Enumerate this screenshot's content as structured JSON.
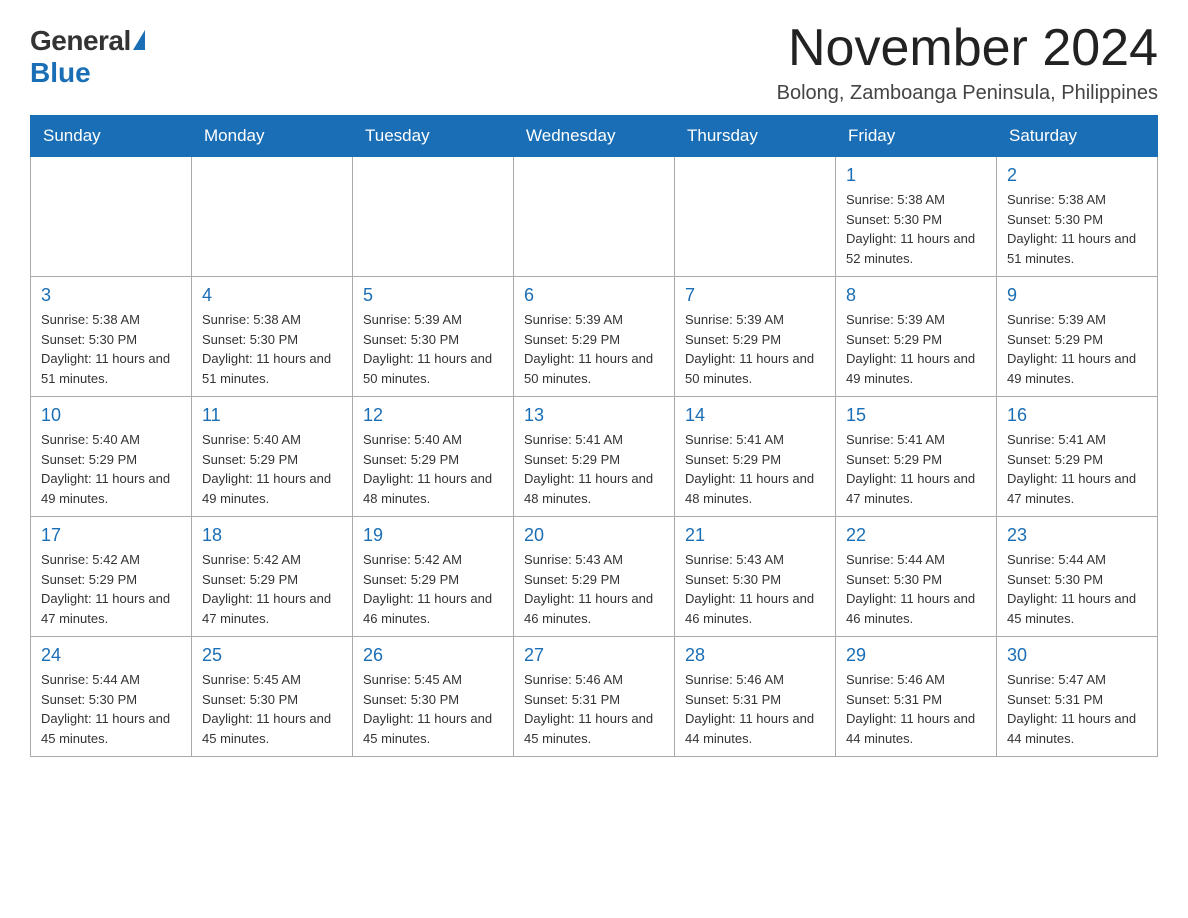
{
  "logo": {
    "general": "General",
    "blue": "Blue"
  },
  "header": {
    "month_title": "November 2024",
    "location": "Bolong, Zamboanga Peninsula, Philippines"
  },
  "days_of_week": [
    "Sunday",
    "Monday",
    "Tuesday",
    "Wednesday",
    "Thursday",
    "Friday",
    "Saturday"
  ],
  "weeks": [
    [
      {
        "day": "",
        "info": ""
      },
      {
        "day": "",
        "info": ""
      },
      {
        "day": "",
        "info": ""
      },
      {
        "day": "",
        "info": ""
      },
      {
        "day": "",
        "info": ""
      },
      {
        "day": "1",
        "info": "Sunrise: 5:38 AM\nSunset: 5:30 PM\nDaylight: 11 hours and 52 minutes."
      },
      {
        "day": "2",
        "info": "Sunrise: 5:38 AM\nSunset: 5:30 PM\nDaylight: 11 hours and 51 minutes."
      }
    ],
    [
      {
        "day": "3",
        "info": "Sunrise: 5:38 AM\nSunset: 5:30 PM\nDaylight: 11 hours and 51 minutes."
      },
      {
        "day": "4",
        "info": "Sunrise: 5:38 AM\nSunset: 5:30 PM\nDaylight: 11 hours and 51 minutes."
      },
      {
        "day": "5",
        "info": "Sunrise: 5:39 AM\nSunset: 5:30 PM\nDaylight: 11 hours and 50 minutes."
      },
      {
        "day": "6",
        "info": "Sunrise: 5:39 AM\nSunset: 5:29 PM\nDaylight: 11 hours and 50 minutes."
      },
      {
        "day": "7",
        "info": "Sunrise: 5:39 AM\nSunset: 5:29 PM\nDaylight: 11 hours and 50 minutes."
      },
      {
        "day": "8",
        "info": "Sunrise: 5:39 AM\nSunset: 5:29 PM\nDaylight: 11 hours and 49 minutes."
      },
      {
        "day": "9",
        "info": "Sunrise: 5:39 AM\nSunset: 5:29 PM\nDaylight: 11 hours and 49 minutes."
      }
    ],
    [
      {
        "day": "10",
        "info": "Sunrise: 5:40 AM\nSunset: 5:29 PM\nDaylight: 11 hours and 49 minutes."
      },
      {
        "day": "11",
        "info": "Sunrise: 5:40 AM\nSunset: 5:29 PM\nDaylight: 11 hours and 49 minutes."
      },
      {
        "day": "12",
        "info": "Sunrise: 5:40 AM\nSunset: 5:29 PM\nDaylight: 11 hours and 48 minutes."
      },
      {
        "day": "13",
        "info": "Sunrise: 5:41 AM\nSunset: 5:29 PM\nDaylight: 11 hours and 48 minutes."
      },
      {
        "day": "14",
        "info": "Sunrise: 5:41 AM\nSunset: 5:29 PM\nDaylight: 11 hours and 48 minutes."
      },
      {
        "day": "15",
        "info": "Sunrise: 5:41 AM\nSunset: 5:29 PM\nDaylight: 11 hours and 47 minutes."
      },
      {
        "day": "16",
        "info": "Sunrise: 5:41 AM\nSunset: 5:29 PM\nDaylight: 11 hours and 47 minutes."
      }
    ],
    [
      {
        "day": "17",
        "info": "Sunrise: 5:42 AM\nSunset: 5:29 PM\nDaylight: 11 hours and 47 minutes."
      },
      {
        "day": "18",
        "info": "Sunrise: 5:42 AM\nSunset: 5:29 PM\nDaylight: 11 hours and 47 minutes."
      },
      {
        "day": "19",
        "info": "Sunrise: 5:42 AM\nSunset: 5:29 PM\nDaylight: 11 hours and 46 minutes."
      },
      {
        "day": "20",
        "info": "Sunrise: 5:43 AM\nSunset: 5:29 PM\nDaylight: 11 hours and 46 minutes."
      },
      {
        "day": "21",
        "info": "Sunrise: 5:43 AM\nSunset: 5:30 PM\nDaylight: 11 hours and 46 minutes."
      },
      {
        "day": "22",
        "info": "Sunrise: 5:44 AM\nSunset: 5:30 PM\nDaylight: 11 hours and 46 minutes."
      },
      {
        "day": "23",
        "info": "Sunrise: 5:44 AM\nSunset: 5:30 PM\nDaylight: 11 hours and 45 minutes."
      }
    ],
    [
      {
        "day": "24",
        "info": "Sunrise: 5:44 AM\nSunset: 5:30 PM\nDaylight: 11 hours and 45 minutes."
      },
      {
        "day": "25",
        "info": "Sunrise: 5:45 AM\nSunset: 5:30 PM\nDaylight: 11 hours and 45 minutes."
      },
      {
        "day": "26",
        "info": "Sunrise: 5:45 AM\nSunset: 5:30 PM\nDaylight: 11 hours and 45 minutes."
      },
      {
        "day": "27",
        "info": "Sunrise: 5:46 AM\nSunset: 5:31 PM\nDaylight: 11 hours and 45 minutes."
      },
      {
        "day": "28",
        "info": "Sunrise: 5:46 AM\nSunset: 5:31 PM\nDaylight: 11 hours and 44 minutes."
      },
      {
        "day": "29",
        "info": "Sunrise: 5:46 AM\nSunset: 5:31 PM\nDaylight: 11 hours and 44 minutes."
      },
      {
        "day": "30",
        "info": "Sunrise: 5:47 AM\nSunset: 5:31 PM\nDaylight: 11 hours and 44 minutes."
      }
    ]
  ]
}
